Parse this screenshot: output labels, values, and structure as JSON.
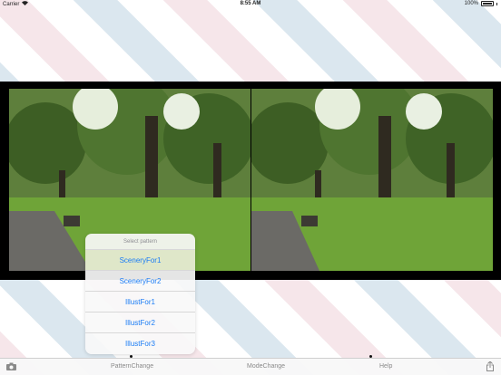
{
  "status_bar": {
    "carrier": "Carrier",
    "time": "8:55 AM",
    "battery": "100%"
  },
  "images": {
    "left": "scenery-photo-left",
    "right": "scenery-photo-right"
  },
  "picker": {
    "title": "Select pattern",
    "selected_index": 0,
    "items": [
      {
        "label": "SceneryFor1"
      },
      {
        "label": "SceneryFor2"
      },
      {
        "label": "IllustFor1"
      },
      {
        "label": "IllustFor2"
      },
      {
        "label": "IllustFor3"
      }
    ]
  },
  "toolbar": {
    "camera_icon": "camera-icon",
    "pattern_label": "PatternChange",
    "mode_label": "ModeChange",
    "help_label": "Help",
    "share_icon": "share-icon"
  },
  "colors": {
    "accent": "#1a7cf5",
    "selected_row": "#dfe7c9"
  }
}
